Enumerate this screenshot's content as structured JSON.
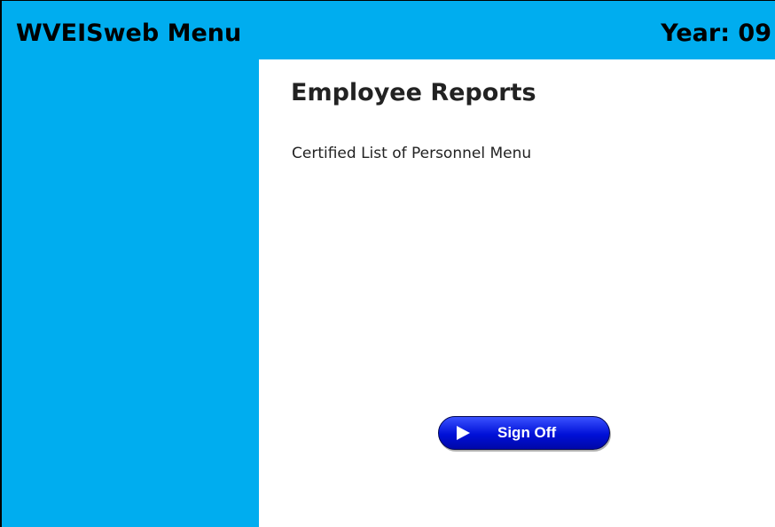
{
  "header": {
    "app_title": "WVEISweb Menu",
    "year": "Year: 09"
  },
  "main": {
    "page_title": "Employee Reports",
    "menu_items": [
      {
        "label": "Certified List of Personnel Menu"
      }
    ],
    "sign_off_label": "Sign Off"
  },
  "colors": {
    "header_bg": "#00adef",
    "sidebar_bg": "#00adef",
    "button_blue": "#0010d8"
  },
  "icons": {
    "sign_off": "play-icon"
  }
}
